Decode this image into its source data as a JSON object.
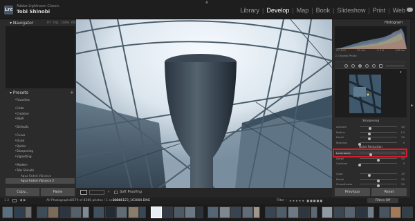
{
  "app": {
    "catalog": "Adobe Lightroom Classic",
    "user": "Tobi Shinobi",
    "logo": "Lrc",
    "modules": [
      "Library",
      "Develop",
      "Map",
      "Book",
      "Slideshow",
      "Print",
      "Web"
    ],
    "active_module": "Develop"
  },
  "left": {
    "navigator": "Navigator",
    "nav_options": "FIT  FILL  100%  6%",
    "presets": "Presets",
    "preset_items": [
      {
        "label": "Favorites",
        "type": "group"
      },
      {
        "label": "",
        "type": "gap"
      },
      {
        "label": "Color",
        "type": "group"
      },
      {
        "label": "Creative",
        "type": "group"
      },
      {
        "label": "B&W",
        "type": "group"
      },
      {
        "label": "",
        "type": "gap"
      },
      {
        "label": "Defaults",
        "type": "group"
      },
      {
        "label": "",
        "type": "gap"
      },
      {
        "label": "Curve",
        "type": "group"
      },
      {
        "label": "Grain",
        "type": "group"
      },
      {
        "label": "Optics",
        "type": "group"
      },
      {
        "label": "Sharpening",
        "type": "group"
      },
      {
        "label": "Vignetting",
        "type": "group"
      },
      {
        "label": "",
        "type": "gap"
      },
      {
        "label": "Modern",
        "type": "group"
      },
      {
        "label": "Tobi Shinobi",
        "type": "group"
      },
      {
        "label": "Aqua Faded Vibrance",
        "type": "sub"
      },
      {
        "label": "Aqua Faded Vibrance 2",
        "type": "sub-selected"
      }
    ],
    "copy": "Copy...",
    "paste": "Paste"
  },
  "toolbar": {
    "soft_proofing": "Soft Proofing"
  },
  "right": {
    "histogram": "Histogram",
    "histo_info": [
      "ISO 800",
      "35 mm",
      "f / 2.8",
      "1/60 sec"
    ],
    "original_photo": "Original Photo",
    "sharpening": "Sharpening",
    "sharpen_rows": [
      {
        "label": "Amount",
        "value": "40",
        "pos": 0.27
      },
      {
        "label": "Radius",
        "value": "1.0",
        "pos": 0.25
      },
      {
        "label": "Detail",
        "value": "25",
        "pos": 0.25
      },
      {
        "label": "Masking",
        "value": "0",
        "pos": 0.0
      }
    ],
    "noise_reduction": "Noise Reduction",
    "nr_rows": [
      {
        "label": "Luminance",
        "value": "30",
        "pos": 0.3,
        "highlighted": true
      },
      {
        "label": "Detail",
        "value": "50",
        "pos": 0.5
      },
      {
        "label": "Contrast",
        "value": "0",
        "pos": 0.0
      },
      {
        "label": "",
        "value": "",
        "pos": null
      },
      {
        "label": "Color",
        "value": "25",
        "pos": 0.25
      },
      {
        "label": "Detail",
        "value": "50",
        "pos": 0.5
      },
      {
        "label": "Smoothness",
        "value": "50",
        "pos": 0.5
      }
    ],
    "previous": "Previous",
    "reset": "Reset"
  },
  "filmstrip": {
    "page_nums": "1  2",
    "source": "All Photographs",
    "count": "8579 of 8580 photos / 1 selected /",
    "file": "20201123_163000.DNG",
    "filter_label": "Filter :",
    "filter_value": "Filters Off",
    "thumb_colors": [
      "#5a6f80",
      "#2f3f50",
      "#6f6f6f",
      "#3e4c58",
      "#7a6a5a",
      "#2c3540",
      "#55606a",
      "#808a93",
      "#40505e",
      "#222a33",
      "#5f6b75",
      "#8a7c6c",
      "#3a4856",
      "#e8eef4",
      "#313a44",
      "#4d5a66",
      "#6b7884",
      "#2a323c",
      "#556575",
      "#7f8890",
      "#3a4450",
      "#606d78",
      "#a0968a",
      "#394552",
      "#4f5d6a",
      "#6d7a86",
      "#2e3640",
      "#5c6874",
      "#909aa3",
      "#3c4752",
      "#57636f",
      "#2d3540",
      "#717d88",
      "#48545f",
      "#a27a5a",
      "#344049"
    ]
  }
}
